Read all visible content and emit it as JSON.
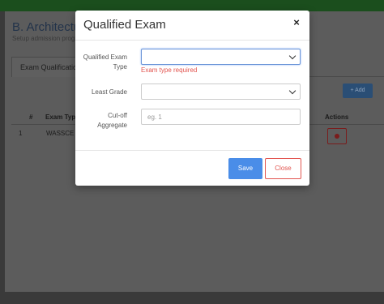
{
  "background": {
    "title": "B. Architectur",
    "subtitle": "Setup admission progr",
    "tab_label": "Exam Qualification",
    "add_button": "+ Add",
    "table": {
      "headers": [
        "#",
        "Exam Type",
        "Actions"
      ],
      "rows": [
        [
          "1",
          "WASSCE"
        ]
      ]
    }
  },
  "modal": {
    "title": "Qualified Exam",
    "close_icon": "×",
    "fields": {
      "exam_type_label": "Qualified Exam Type",
      "exam_type_error": "Exam type required",
      "least_grade_label": "Least Grade",
      "cutoff_label": "Cut-off Aggregate",
      "cutoff_placeholder": "eg. 1"
    },
    "save_label": "Save",
    "close_label": "Close"
  },
  "colors": {
    "primary": "#4a8de8",
    "danger": "#e2544f"
  }
}
